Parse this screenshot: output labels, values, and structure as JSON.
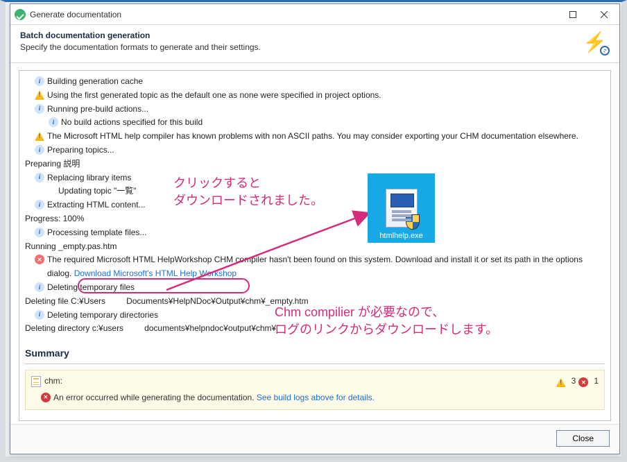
{
  "titlebar": {
    "title": "Generate documentation"
  },
  "subheader": {
    "heading": "Batch documentation generation",
    "sub": "Specify the documentation formats to generate and their settings."
  },
  "log": {
    "l1": "Building generation cache",
    "l2": "Using the first generated topic as the default one as none were specified in project options.",
    "l3": "Running pre-build actions...",
    "l4": "No build actions specified for this build",
    "l5": "The Microsoft HTML help compiler has known problems with non ASCII paths. You may consider exporting your CHM documentation elsewhere.",
    "l6": "Preparing topics...",
    "l7": "Preparing 説明",
    "l8": "Replacing library items",
    "l9": "Updating topic \"一覧\"",
    "l10": "Extracting HTML content...",
    "l11": "Progress: 100%",
    "l12": "Processing template files...",
    "l13": "Running _empty.pas.htm",
    "l14a": "The required Microsoft HTML HelpWorkshop CHM compiler hasn't been found on this system. Download and install it or set its path in the options dialog.",
    "l14b": "Download Microsoft's HTML Help Workshop",
    "l15": "Deleting temporary files",
    "l16a": "Deleting file C:¥Users",
    "l16b": "Documents¥HelpNDoc¥Output¥chm¥_empty.htm",
    "l17": "Deleting temporary directories",
    "l18a": "Deleting directory c:¥users",
    "l18b": "documents¥helpndoc¥output¥chm¥"
  },
  "summary": {
    "heading": "Summary",
    "name": "chm:",
    "warn_count": "3",
    "err_count": "1",
    "msg": "An error occurred while generating the documentation. ",
    "link": "See build logs above for details."
  },
  "buttons": {
    "close": "Close"
  },
  "annotations": {
    "a1_l1": "クリックすると",
    "a1_l2": "ダウンロードされました。",
    "a2_l1": "Chm compilier が必要なので、",
    "a2_l2": "ログのリンクからダウンロードします。",
    "desktop_label": "htmlhelp.exe"
  }
}
